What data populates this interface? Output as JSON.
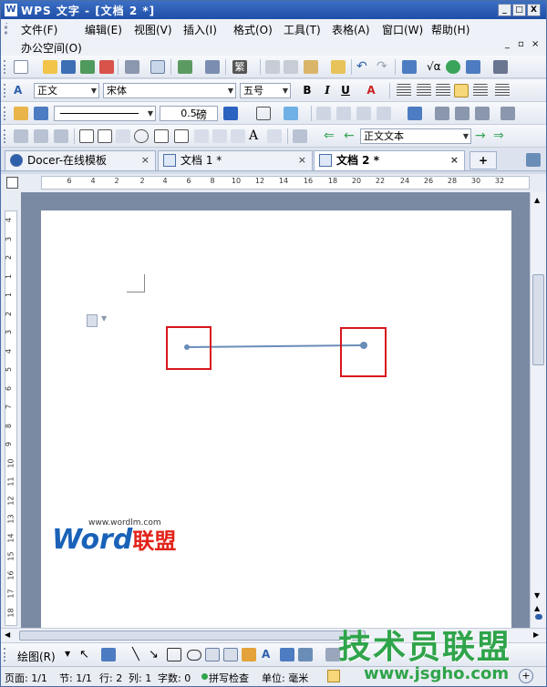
{
  "titlebar": {
    "logo": "W",
    "title": "WPS 文字 - [文档 2 *]",
    "buttons": [
      "_",
      "□",
      "X"
    ]
  },
  "menu": {
    "items": [
      "文件(F)",
      "编辑(E)",
      "视图(V)",
      "插入(I)",
      "格式(O)",
      "工具(T)",
      "表格(A)",
      "窗口(W)",
      "帮助(H)"
    ],
    "second_row": "办公空间(O)"
  },
  "format_bar": {
    "style": "正文",
    "font": "宋体",
    "size": "五号",
    "bold": "B",
    "italic": "I",
    "underline": "U",
    "font_color": "A"
  },
  "line_bar": {
    "weight": "0.5",
    "unit": "磅"
  },
  "form_bar": {
    "style_box": "正文文本"
  },
  "tabs": [
    {
      "label": "Docer-在线模板",
      "close": "×"
    },
    {
      "label": "文档 1 *",
      "close": "×"
    },
    {
      "label": "文档 2 *",
      "close": "×",
      "active": true
    }
  ],
  "tab_add": "+",
  "hruler": {
    "numbers": [
      "6",
      "4",
      "2",
      "2",
      "4",
      "6",
      "8",
      "10",
      "12",
      "14",
      "16",
      "18",
      "20",
      "22",
      "24",
      "26",
      "28",
      "30",
      "32"
    ]
  },
  "vruler": {
    "numbers": [
      "4",
      "3",
      "2",
      "1",
      "1",
      "2",
      "3",
      "4",
      "5",
      "6",
      "7",
      "8",
      "9",
      "10",
      "11",
      "12",
      "13",
      "14",
      "15",
      "16",
      "17",
      "18"
    ]
  },
  "drawbar": {
    "label": "绘图(R)"
  },
  "status": {
    "page": "页面: 1/1",
    "section": "节: 1/1",
    "row": "行: 2",
    "col": "列: 1",
    "words": "字数: 0",
    "spell": "拼写检查",
    "unit": "单位: 毫米"
  },
  "watermarks": {
    "word_url": "www.wordlm.com",
    "word_main": "Word",
    "word_cn": "联盟",
    "site_cn": "技术员联盟",
    "site_url": "www.jsgho.com"
  },
  "colors": {
    "title_bar": "#2a5cb4",
    "line": "#6a8db8",
    "highlight_box": "#d8161d",
    "watermark_green": "#2fa44a",
    "watermark_blue": "#1a62b8"
  }
}
